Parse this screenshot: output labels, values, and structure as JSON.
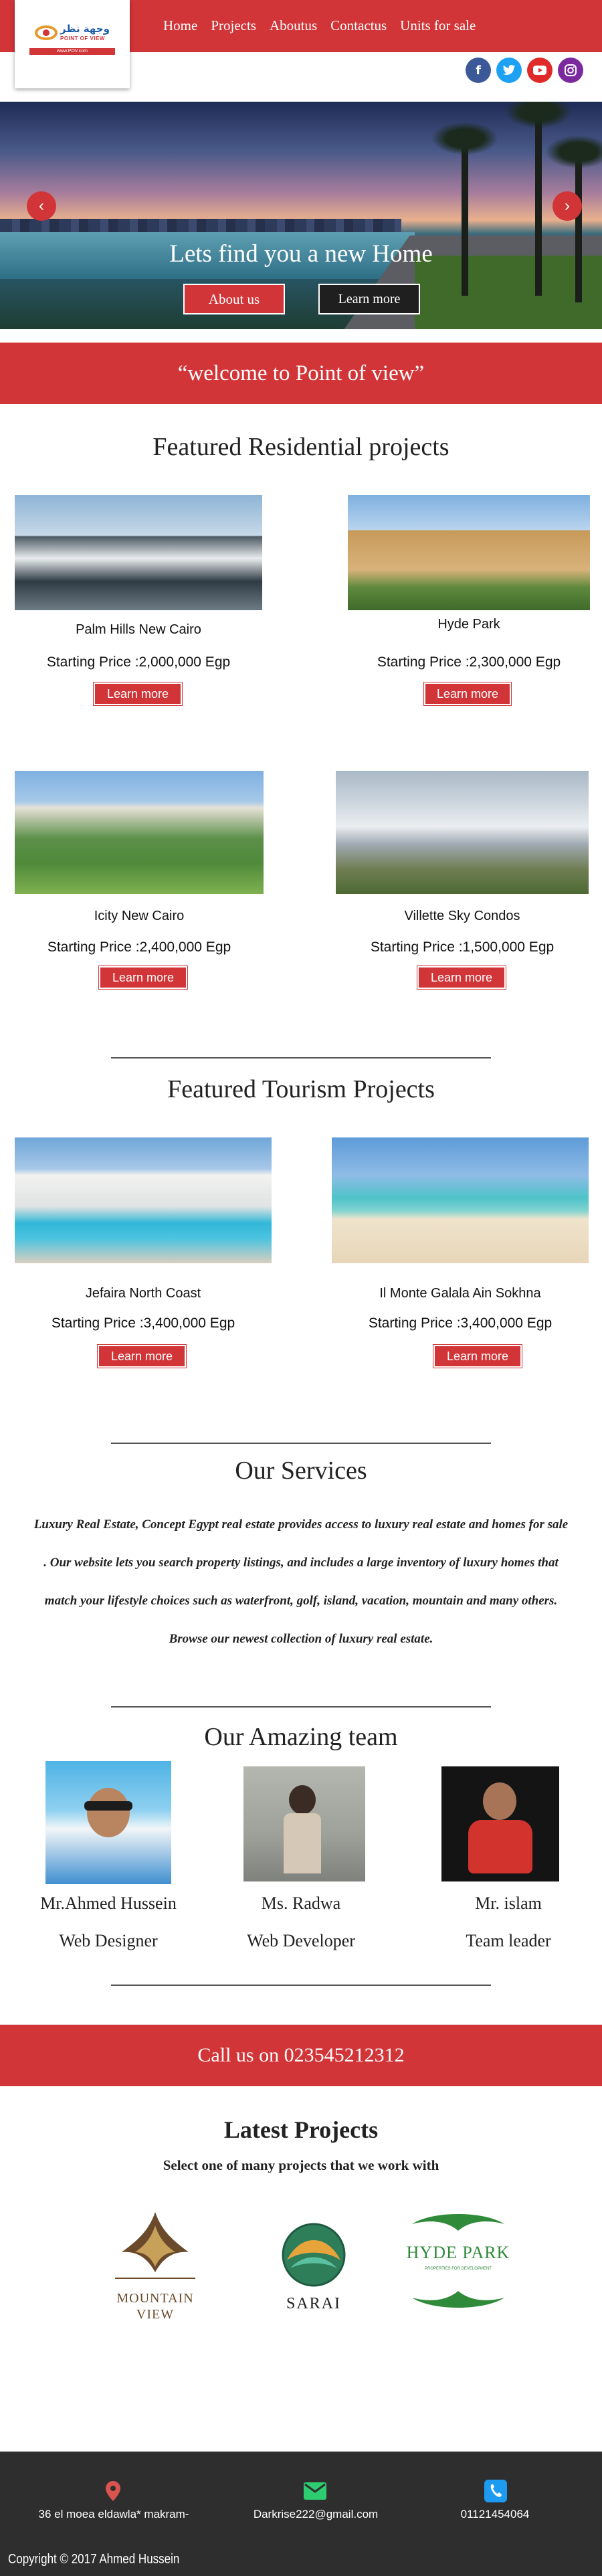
{
  "brand": {
    "logo_ar": "وجهة نظر",
    "logo_en": "POINT OF VIEW",
    "logo_site": "www.POV.com"
  },
  "nav": {
    "items": [
      "Home",
      "Projects",
      "Aboutus",
      "Contactus",
      "Units for sale"
    ]
  },
  "social": [
    "facebook-icon",
    "twitter-icon",
    "youtube-icon",
    "instagram-icon"
  ],
  "hero": {
    "title": "Lets find you a new Home",
    "about_label": "About us",
    "learn_label": "Learn more",
    "prev": "‹",
    "next": "›"
  },
  "welcome": "“welcome to Point of view”",
  "residential": {
    "title": "Featured Residential projects",
    "projects": [
      {
        "name": "Palm Hills New Cairo",
        "price": "Starting  Price :2,000,000 Egp",
        "button": "Learn more"
      },
      {
        "name": "Hyde Park",
        "price": "Starting  Price :2,300,000 Egp",
        "button": "Learn more"
      },
      {
        "name": "Icity New Cairo",
        "price": "Starting  Price :2,400,000 Egp",
        "button": "Learn more"
      },
      {
        "name": "Villette Sky Condos",
        "price": "Starting  Price :1,500,000 Egp",
        "button": "Learn more"
      }
    ]
  },
  "tourism": {
    "title": "Featured Tourism Projects",
    "projects": [
      {
        "name": "Jefaira North Coast",
        "price": "Starting  Price :3,400,000 Egp",
        "button": "Learn more"
      },
      {
        "name": "Il Monte Galala Ain Sokhna",
        "price": "Starting  Price :3,400,000 Egp",
        "button": "Learn more"
      }
    ]
  },
  "services": {
    "title": "Our Services",
    "text": "Luxury Real Estate, Concept Egypt real estate provides access to luxury real estate and homes for sale . Our website lets you search property listings, and includes a large inventory of luxury homes that match your lifestyle choices such as waterfront, golf, island, vacation, mountain and many others. Browse our newest collection of luxury real estate."
  },
  "team": {
    "title": "Our Amazing team",
    "members": [
      {
        "name": "Mr.Ahmed Hussein",
        "role": "Web Designer"
      },
      {
        "name": "Ms. Radwa",
        "role": "Web Developer"
      },
      {
        "name": "Mr. islam",
        "role": "Team leader"
      }
    ]
  },
  "call": "Call us on 023545212312",
  "latest": {
    "title": "Latest Projects",
    "subtitle": "Select one of many projects that we work with",
    "logos": [
      {
        "line1": "MOUNTAIN",
        "line2": "VIEW"
      },
      {
        "line1": "SARAI"
      },
      {
        "line1": "HYDE PARK",
        "line2": "PROPERTIES FOR DEVELOPMENT"
      }
    ]
  },
  "footer": {
    "address": "36  el moea eldawla* makram-",
    "email": "Darkrise222@gmail.com",
    "phone": "01121454064",
    "copyright": "Copyright © 2017 Ahmed Hussein"
  },
  "colors": {
    "accent": "#d13538",
    "footer": "#2e2e2e"
  }
}
